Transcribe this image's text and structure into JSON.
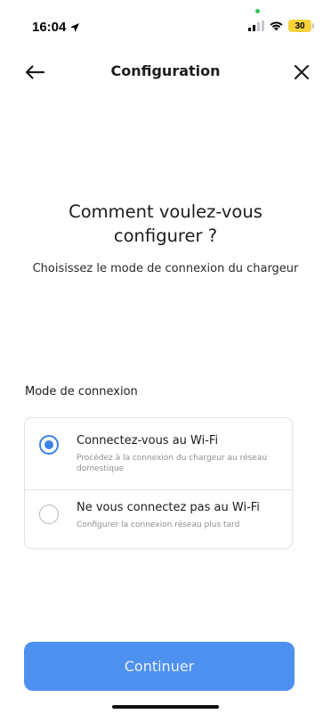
{
  "status_bar": {
    "time": "16:04",
    "battery": "30"
  },
  "header": {
    "title": "Configuration"
  },
  "hero": {
    "title": "Comment voulez-vous configurer ?",
    "subtitle": "Choisissez le mode de connexion du chargeur"
  },
  "connection": {
    "section_label": "Mode de connexion",
    "options": [
      {
        "title": "Connectez-vous au Wi-Fi",
        "description": "Procédez à la connexion du chargeur au réseau domestique",
        "selected": true
      },
      {
        "title": "Ne vous connectez pas au Wi-Fi",
        "description": "Configurer la connexion réseau plus tard",
        "selected": false
      }
    ]
  },
  "footer": {
    "continue_label": "Continuer"
  },
  "colors": {
    "accent": "#3d82e6",
    "button": "#4d90f0",
    "battery": "#f7d23c"
  },
  "icons": {
    "back": "arrow-left-icon",
    "close": "close-icon",
    "location": "location-arrow-icon",
    "signal": "cellular-signal-icon",
    "wifi": "wifi-icon"
  }
}
